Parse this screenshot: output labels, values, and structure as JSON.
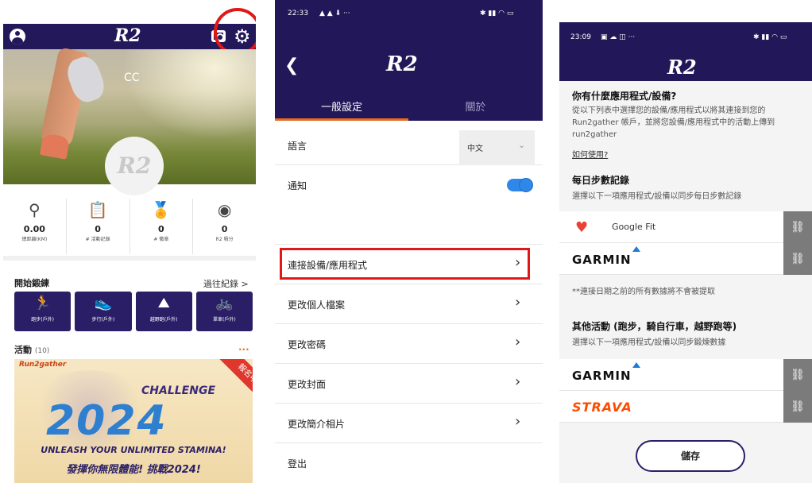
{
  "profile": {
    "logo": "R2",
    "user_name": "CC",
    "avatar_text": "R2",
    "stats": [
      {
        "value": "0.00",
        "label": "總距離(KM)"
      },
      {
        "value": "0",
        "label": "# 活動記錄"
      },
      {
        "value": "0",
        "label": "# 徽章"
      },
      {
        "value": "0",
        "label": "R2 積分"
      }
    ],
    "start_training": "開始鍛練",
    "past_records": "過往紀錄 >",
    "trainings": [
      {
        "label": "跑步(戶外)"
      },
      {
        "label": "步行(戶外)"
      },
      {
        "label": "越野跑(戶外)"
      },
      {
        "label": "單車(戶外)"
      }
    ],
    "activities_title": "活動",
    "activities_count": "(10)",
    "more": "...",
    "banner": {
      "brand": "Run2gather",
      "challenge": "CHALLENGE",
      "year": "2024",
      "slogan": "UNLEASH YOUR UNLIMITED STAMINA!",
      "chinese": "發揮你無限體能! 挑戰2024!",
      "ribbon": "報名中"
    }
  },
  "settings": {
    "status_time": "22:33",
    "logo": "R2",
    "tabs": [
      "一般設定",
      "關於"
    ],
    "language_label": "語言",
    "language_value": "中文",
    "notification_label": "通知",
    "menu": [
      {
        "label": "連接設備/應用程式"
      },
      {
        "label": "更改個人檔案"
      },
      {
        "label": "更改密碼"
      },
      {
        "label": "更改封面"
      },
      {
        "label": "更改簡介相片"
      }
    ],
    "logout": "登出"
  },
  "connect": {
    "status_time": "23:09",
    "logo": "R2",
    "question": "你有什麼應用程式/設備?",
    "desc": "從以下列表中選擇您的設備/應用程式以將其連接到您的 Run2gather 帳戶，並將您設備/應用程式中的活動上傳到 run2gather",
    "howto": "如何使用?",
    "steps_title": "每日步數記錄",
    "steps_desc": "選擇以下一項應用程式/設備以同步每日步數記錄",
    "google_fit": "Google Fit",
    "garmin": "GARMIN",
    "note": "**連接日期之前的所有數據將不會被提取",
    "other_title": "其他活動 (跑步，騎自行車，越野跑等)",
    "other_desc": "選擇以下一項應用程式/設備以同步鍛煉數據",
    "strava": "STRAVA",
    "save": "儲存"
  }
}
